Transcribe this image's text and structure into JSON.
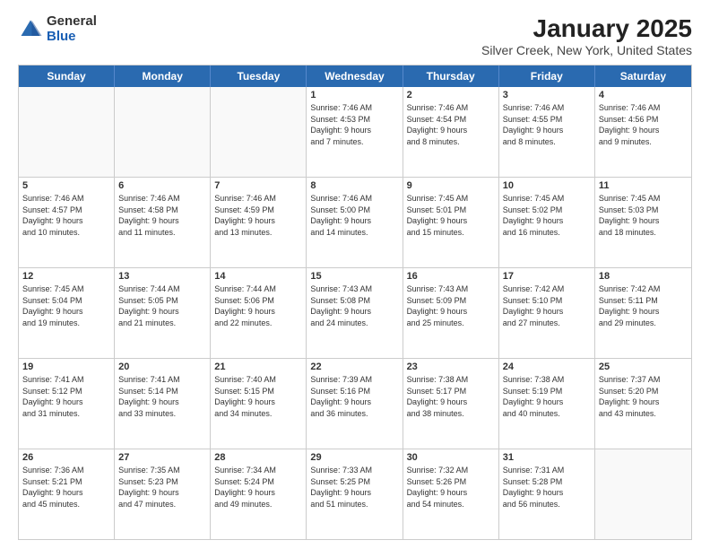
{
  "logo": {
    "general": "General",
    "blue": "Blue"
  },
  "title": {
    "month": "January 2025",
    "location": "Silver Creek, New York, United States"
  },
  "header": {
    "days": [
      "Sunday",
      "Monday",
      "Tuesday",
      "Wednesday",
      "Thursday",
      "Friday",
      "Saturday"
    ]
  },
  "rows": [
    [
      {
        "day": "",
        "info": "",
        "empty": true
      },
      {
        "day": "",
        "info": "",
        "empty": true
      },
      {
        "day": "",
        "info": "",
        "empty": true
      },
      {
        "day": "1",
        "info": "Sunrise: 7:46 AM\nSunset: 4:53 PM\nDaylight: 9 hours\nand 7 minutes.",
        "empty": false
      },
      {
        "day": "2",
        "info": "Sunrise: 7:46 AM\nSunset: 4:54 PM\nDaylight: 9 hours\nand 8 minutes.",
        "empty": false
      },
      {
        "day": "3",
        "info": "Sunrise: 7:46 AM\nSunset: 4:55 PM\nDaylight: 9 hours\nand 8 minutes.",
        "empty": false
      },
      {
        "day": "4",
        "info": "Sunrise: 7:46 AM\nSunset: 4:56 PM\nDaylight: 9 hours\nand 9 minutes.",
        "empty": false
      }
    ],
    [
      {
        "day": "5",
        "info": "Sunrise: 7:46 AM\nSunset: 4:57 PM\nDaylight: 9 hours\nand 10 minutes.",
        "empty": false
      },
      {
        "day": "6",
        "info": "Sunrise: 7:46 AM\nSunset: 4:58 PM\nDaylight: 9 hours\nand 11 minutes.",
        "empty": false
      },
      {
        "day": "7",
        "info": "Sunrise: 7:46 AM\nSunset: 4:59 PM\nDaylight: 9 hours\nand 13 minutes.",
        "empty": false
      },
      {
        "day": "8",
        "info": "Sunrise: 7:46 AM\nSunset: 5:00 PM\nDaylight: 9 hours\nand 14 minutes.",
        "empty": false
      },
      {
        "day": "9",
        "info": "Sunrise: 7:45 AM\nSunset: 5:01 PM\nDaylight: 9 hours\nand 15 minutes.",
        "empty": false
      },
      {
        "day": "10",
        "info": "Sunrise: 7:45 AM\nSunset: 5:02 PM\nDaylight: 9 hours\nand 16 minutes.",
        "empty": false
      },
      {
        "day": "11",
        "info": "Sunrise: 7:45 AM\nSunset: 5:03 PM\nDaylight: 9 hours\nand 18 minutes.",
        "empty": false
      }
    ],
    [
      {
        "day": "12",
        "info": "Sunrise: 7:45 AM\nSunset: 5:04 PM\nDaylight: 9 hours\nand 19 minutes.",
        "empty": false
      },
      {
        "day": "13",
        "info": "Sunrise: 7:44 AM\nSunset: 5:05 PM\nDaylight: 9 hours\nand 21 minutes.",
        "empty": false
      },
      {
        "day": "14",
        "info": "Sunrise: 7:44 AM\nSunset: 5:06 PM\nDaylight: 9 hours\nand 22 minutes.",
        "empty": false
      },
      {
        "day": "15",
        "info": "Sunrise: 7:43 AM\nSunset: 5:08 PM\nDaylight: 9 hours\nand 24 minutes.",
        "empty": false
      },
      {
        "day": "16",
        "info": "Sunrise: 7:43 AM\nSunset: 5:09 PM\nDaylight: 9 hours\nand 25 minutes.",
        "empty": false
      },
      {
        "day": "17",
        "info": "Sunrise: 7:42 AM\nSunset: 5:10 PM\nDaylight: 9 hours\nand 27 minutes.",
        "empty": false
      },
      {
        "day": "18",
        "info": "Sunrise: 7:42 AM\nSunset: 5:11 PM\nDaylight: 9 hours\nand 29 minutes.",
        "empty": false
      }
    ],
    [
      {
        "day": "19",
        "info": "Sunrise: 7:41 AM\nSunset: 5:12 PM\nDaylight: 9 hours\nand 31 minutes.",
        "empty": false
      },
      {
        "day": "20",
        "info": "Sunrise: 7:41 AM\nSunset: 5:14 PM\nDaylight: 9 hours\nand 33 minutes.",
        "empty": false
      },
      {
        "day": "21",
        "info": "Sunrise: 7:40 AM\nSunset: 5:15 PM\nDaylight: 9 hours\nand 34 minutes.",
        "empty": false
      },
      {
        "day": "22",
        "info": "Sunrise: 7:39 AM\nSunset: 5:16 PM\nDaylight: 9 hours\nand 36 minutes.",
        "empty": false
      },
      {
        "day": "23",
        "info": "Sunrise: 7:38 AM\nSunset: 5:17 PM\nDaylight: 9 hours\nand 38 minutes.",
        "empty": false
      },
      {
        "day": "24",
        "info": "Sunrise: 7:38 AM\nSunset: 5:19 PM\nDaylight: 9 hours\nand 40 minutes.",
        "empty": false
      },
      {
        "day": "25",
        "info": "Sunrise: 7:37 AM\nSunset: 5:20 PM\nDaylight: 9 hours\nand 43 minutes.",
        "empty": false
      }
    ],
    [
      {
        "day": "26",
        "info": "Sunrise: 7:36 AM\nSunset: 5:21 PM\nDaylight: 9 hours\nand 45 minutes.",
        "empty": false
      },
      {
        "day": "27",
        "info": "Sunrise: 7:35 AM\nSunset: 5:23 PM\nDaylight: 9 hours\nand 47 minutes.",
        "empty": false
      },
      {
        "day": "28",
        "info": "Sunrise: 7:34 AM\nSunset: 5:24 PM\nDaylight: 9 hours\nand 49 minutes.",
        "empty": false
      },
      {
        "day": "29",
        "info": "Sunrise: 7:33 AM\nSunset: 5:25 PM\nDaylight: 9 hours\nand 51 minutes.",
        "empty": false
      },
      {
        "day": "30",
        "info": "Sunrise: 7:32 AM\nSunset: 5:26 PM\nDaylight: 9 hours\nand 54 minutes.",
        "empty": false
      },
      {
        "day": "31",
        "info": "Sunrise: 7:31 AM\nSunset: 5:28 PM\nDaylight: 9 hours\nand 56 minutes.",
        "empty": false
      },
      {
        "day": "",
        "info": "",
        "empty": true
      }
    ]
  ]
}
